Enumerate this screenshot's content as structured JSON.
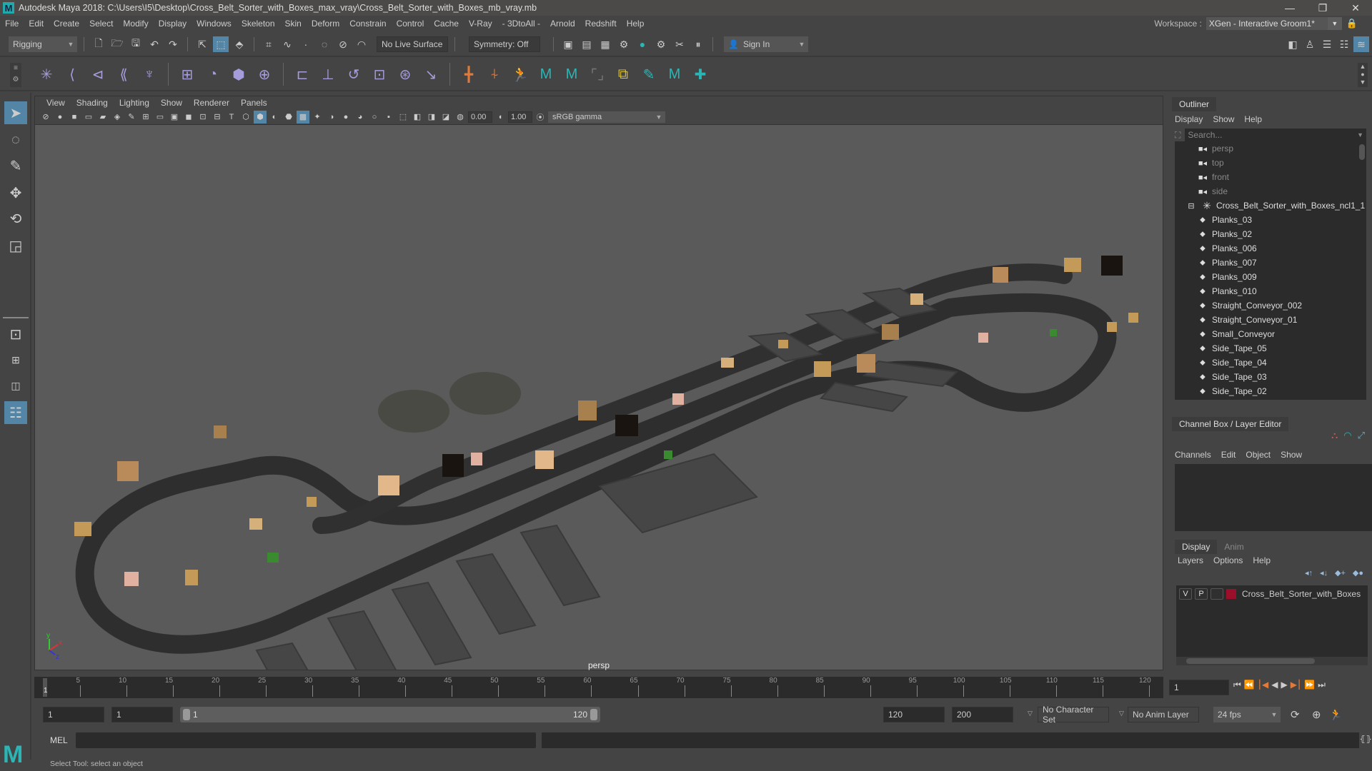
{
  "window": {
    "title": "Autodesk Maya 2018: C:\\Users\\I5\\Desktop\\Cross_Belt_Sorter_with_Boxes_max_vray\\Cross_Belt_Sorter_with_Boxes_mb_vray.mb",
    "logo": "M",
    "controls": {
      "minimize": "—",
      "restore": "❐",
      "close": "✕"
    }
  },
  "menubar": {
    "items": [
      "File",
      "Edit",
      "Create",
      "Select",
      "Modify",
      "Display",
      "Windows",
      "Skeleton",
      "Skin",
      "Deform",
      "Constrain",
      "Control",
      "Cache",
      "V-Ray",
      "- 3DtoAll -",
      "Arnold",
      "Redshift",
      "Help"
    ],
    "workspace_label": "Workspace :",
    "workspace_value": "XGen - Interactive Groom1*"
  },
  "statusline": {
    "menuset": "Rigging",
    "live_surface": "No Live Surface",
    "symmetry": "Symmetry: Off",
    "sign_in": "Sign In"
  },
  "shelf": {
    "icons": [
      "joint-tool",
      "ik-handle",
      "ik-spline",
      "bone-chain",
      "humanik",
      "skin-bind",
      "paint-weights",
      "lattice",
      "wrap",
      "parent-constraint",
      "point-constraint",
      "orient-constraint",
      "scale-constraint",
      "aim-constraint",
      "pole-vector",
      "locator",
      "cluster",
      "character",
      "mash-network",
      "mash-repro",
      "blend-shape",
      "quick-rig",
      "mash-dynamics",
      "add-shelf"
    ]
  },
  "viewport": {
    "menus": [
      "View",
      "Shading",
      "Lighting",
      "Show",
      "Renderer",
      "Panels"
    ],
    "exposure": "0.00",
    "gamma": "1.00",
    "color_space": "sRGB gamma",
    "camera_label": "persp",
    "axis": {
      "x": "x",
      "y": "y",
      "z": "z"
    }
  },
  "outliner": {
    "title": "Outliner",
    "menus": [
      "Display",
      "Show",
      "Help"
    ],
    "search_placeholder": "Search...",
    "cameras": [
      "persp",
      "top",
      "front",
      "side"
    ],
    "group": "Cross_Belt_Sorter_with_Boxes_ncl1_1",
    "children": [
      "Planks_03",
      "Planks_02",
      "Planks_006",
      "Planks_007",
      "Planks_009",
      "Planks_010",
      "Straight_Conveyor_002",
      "Straight_Conveyor_01",
      "Small_Conveyor",
      "Side_Tape_05",
      "Side_Tape_04",
      "Side_Tape_03",
      "Side_Tape_02"
    ]
  },
  "channelbox": {
    "title": "Channel Box / Layer Editor",
    "menus": [
      "Channels",
      "Edit",
      "Object",
      "Show"
    ],
    "layer_tabs": [
      "Display",
      "Anim"
    ],
    "layer_menus": [
      "Layers",
      "Options",
      "Help"
    ],
    "layer": {
      "v": "V",
      "p": "P",
      "name": "Cross_Belt_Sorter_with_Boxes",
      "color": "#9b0f2a"
    }
  },
  "timeline": {
    "ticks": [
      "5",
      "10",
      "15",
      "20",
      "25",
      "30",
      "35",
      "40",
      "45",
      "50",
      "55",
      "60",
      "65",
      "70",
      "75",
      "80",
      "85",
      "90",
      "95",
      "100",
      "105",
      "110",
      "115",
      "120"
    ],
    "range_min": 1,
    "range_max": 120,
    "current_marker": "1",
    "current_frame": "1"
  },
  "range": {
    "start": "1",
    "playback_start": "1",
    "slider_start": "1",
    "slider_end": "120",
    "playback_end": "120",
    "end": "200",
    "character_set": "No Character Set",
    "anim_layer": "No Anim Layer",
    "fps": "24 fps"
  },
  "cmdline": {
    "label": "MEL"
  },
  "helpline": {
    "text": "Select Tool: select an object"
  }
}
